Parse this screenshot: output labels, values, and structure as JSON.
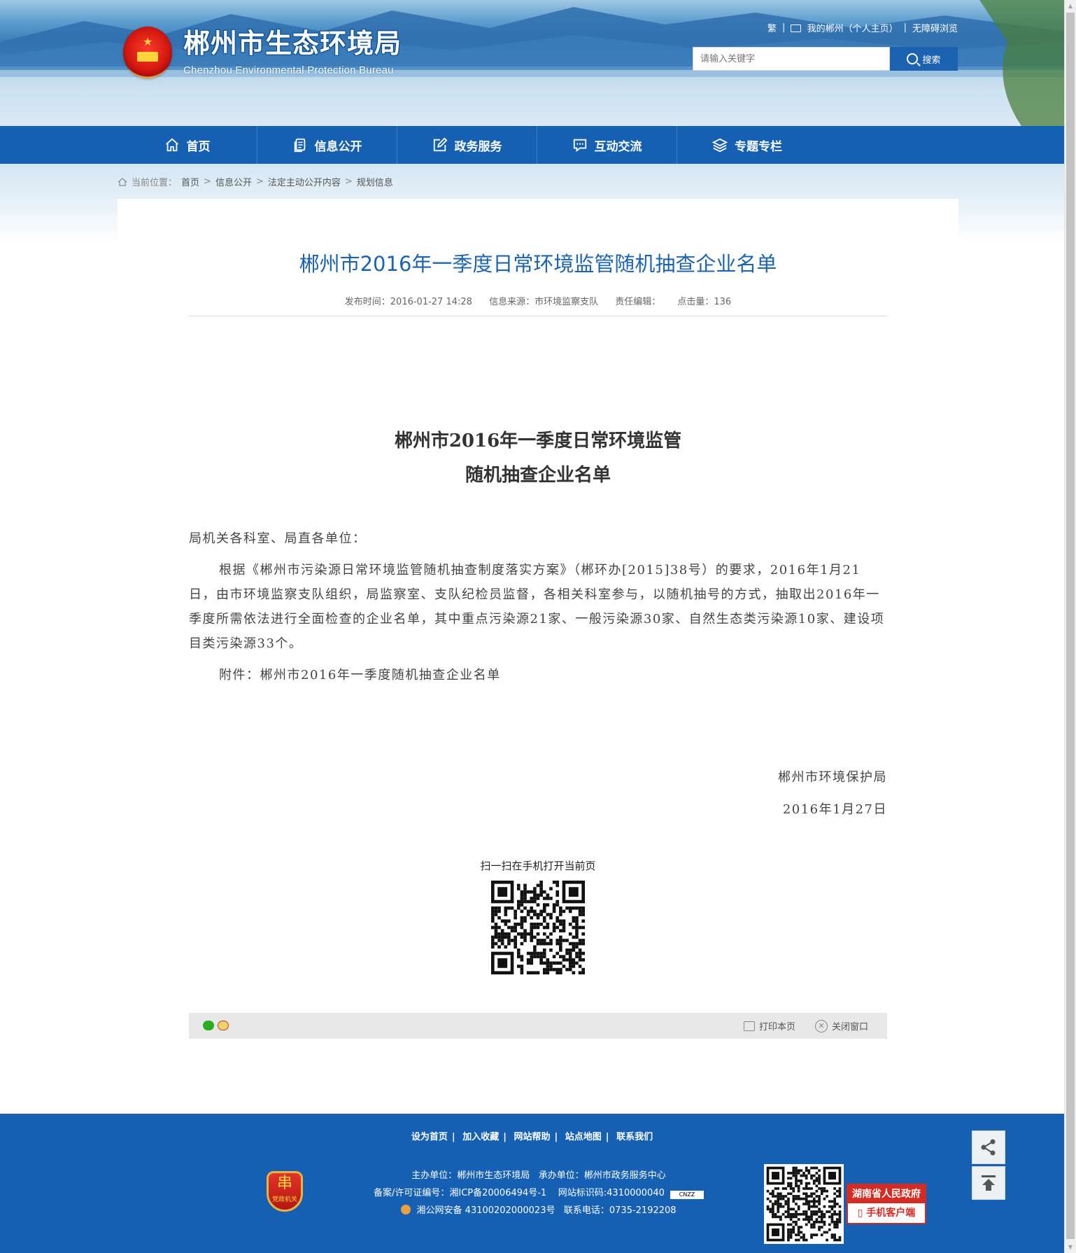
{
  "header": {
    "site_title": "郴州市生态环境局",
    "site_subtitle": "Chenzhou Environmental Protection Bureau",
    "top_links": {
      "traditional": "繁",
      "my_chenzhou": "我的郴州（个人主页）",
      "accessibility": "无障碍浏览"
    },
    "search": {
      "placeholder": "请输入关键字",
      "button_label": "搜索"
    }
  },
  "nav": {
    "items": [
      {
        "label": "首页",
        "icon": "home-icon"
      },
      {
        "label": "信息公开",
        "icon": "document-icon"
      },
      {
        "label": "政务服务",
        "icon": "edit-icon"
      },
      {
        "label": "互动交流",
        "icon": "chat-icon"
      },
      {
        "label": "专题专栏",
        "icon": "layers-icon"
      }
    ]
  },
  "breadcrumb": {
    "label": "当前位置：",
    "items": [
      "首页",
      "信息公开",
      "法定主动公开内容",
      "规划信息"
    ]
  },
  "article": {
    "title": "郴州市2016年一季度日常环境监管随机抽查企业名单",
    "meta": {
      "publish_time": "发布时间：2016-01-27 14:28",
      "source": "信息来源：市环境监察支队",
      "editor": "责任编辑：",
      "clicks": "点击量：136"
    },
    "doc_title_line1": "郴州市2016年一季度日常环境监管",
    "doc_title_line2": "随机抽查企业名单",
    "salutation": "局机关各科室、局直各单位：",
    "paragraph1": "根据《郴州市污染源日常环境监管随机抽查制度落实方案》（郴环办[2015]38号）的要求，2016年1月21日，由市环境监察支队组织，局监察室、支队纪检员监督，各相关科室参与，以随机抽号的方式，抽取出2016年一季度所需依法进行全面检查的企业名单，其中重点污染源21家、一般污染源30家、自然生态类污染源10家、建设项目类污染源33个。",
    "attachment": "附件：郴州市2016年一季度随机抽查企业名单",
    "signature_org": "郴州市环境保护局",
    "signature_date": "2016年1月27日",
    "qr_caption": "扫一扫在手机打开当前页"
  },
  "share_bar": {
    "print_label": "打印本页",
    "close_label": "关闭窗口"
  },
  "footer": {
    "links": [
      "设为首页",
      "加入收藏",
      "网站帮助",
      "站点地图",
      "联系我们"
    ],
    "host": "主办单位：郴州市生态环境局",
    "organizer": "承办单位：郴州市政务服务中心",
    "icp": "备案/许可证编号：湘ICP备20006494号-1",
    "site_id": "网站标识码:4310000040",
    "cnzz": "CNZZ",
    "police": "湘公网安备 43100202000023号",
    "phone": "联系电话：0735-2192208",
    "party_badge_text": "党政机关",
    "hn_gov_line1": "湖南省人民政府",
    "hn_gov_line2": "手机客户端"
  },
  "colors": {
    "brand_blue": "#1560b3",
    "title_blue": "#1c64b0",
    "accent_red": "#d42b23"
  }
}
